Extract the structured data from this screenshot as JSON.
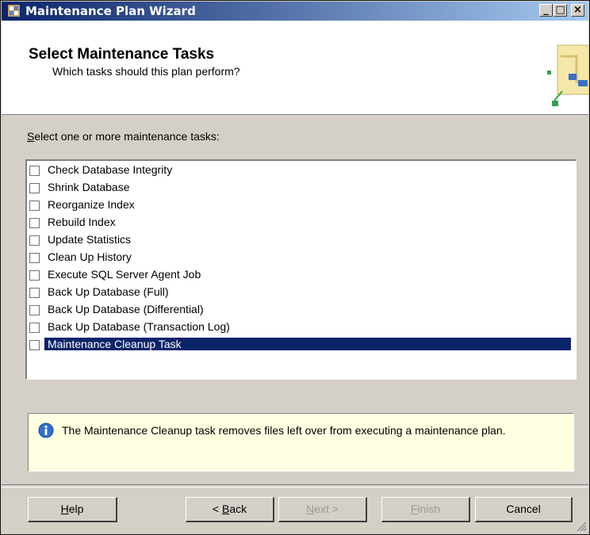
{
  "window": {
    "title": "Maintenance Plan Wizard",
    "controls": {
      "minimize": "_",
      "maximize": "□",
      "close": "×"
    }
  },
  "header": {
    "title": "Select Maintenance Tasks",
    "subtitle": "Which tasks should this plan perform?"
  },
  "prompt": {
    "accel": "S",
    "rest": "elect one or more maintenance tasks:"
  },
  "tasks": [
    {
      "label": "Check Database Integrity",
      "checked": false
    },
    {
      "label": "Shrink Database",
      "checked": false
    },
    {
      "label": "Reorganize Index",
      "checked": false
    },
    {
      "label": "Rebuild Index",
      "checked": false
    },
    {
      "label": "Update Statistics",
      "checked": false
    },
    {
      "label": "Clean Up History",
      "checked": false
    },
    {
      "label": "Execute SQL Server Agent Job",
      "checked": false
    },
    {
      "label": "Back Up Database (Full)",
      "checked": false
    },
    {
      "label": "Back Up Database (Differential)",
      "checked": false
    },
    {
      "label": "Back Up Database (Transaction Log)",
      "checked": false
    },
    {
      "label": "Maintenance Cleanup Task",
      "checked": false,
      "selected": true
    }
  ],
  "info": {
    "icon": "info-icon",
    "text": "The Maintenance Cleanup task removes files left over from executing a maintenance plan."
  },
  "buttons": {
    "help": {
      "accel": "H",
      "rest": "elp"
    },
    "back": {
      "prefix": "< ",
      "accel": "B",
      "rest": "ack"
    },
    "next": {
      "accel": "N",
      "rest": "ext >",
      "enabled": false
    },
    "finish": {
      "accel": "F",
      "rest": "inish",
      "enabled": false
    },
    "cancel": {
      "label": "Cancel"
    }
  },
  "colors": {
    "titlebar_start": "#0a246a",
    "titlebar_end": "#a6caf0",
    "selection": "#0a246a",
    "info_background": "#ffffe1",
    "dialog_face": "#d4d0c8"
  }
}
